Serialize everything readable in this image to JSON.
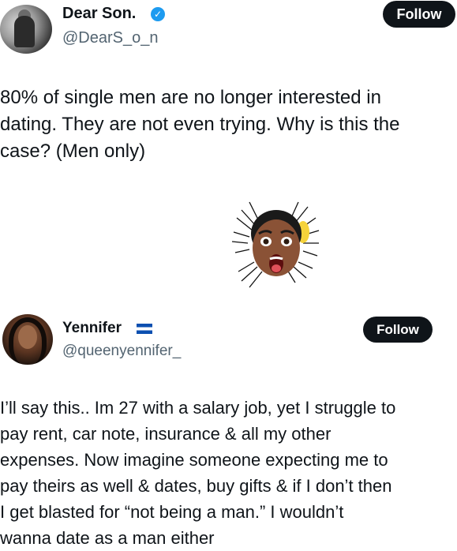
{
  "tweet1": {
    "author_name": "Dear Son.",
    "handle": "@DearS_o_n",
    "follow_label": "Follow",
    "text": "80% of single men are no longer interested in\ndating. They are not even trying. Why is this the\ncase? (Men only)"
  },
  "reply_image": {
    "icon": "shocked-face-emoji"
  },
  "tweet2": {
    "author_name": "Yennifer",
    "handle": "@queenyennifer_",
    "follow_label": "Follow",
    "text": "I’ll say this.. Im 27 with a salary job, yet I struggle to\npay rent, car note, insurance & all my other\nexpenses. Now imagine someone expecting me to\npay theirs as well & dates, buy gifts & if I don’t then\nI get blasted for “not being a man.” I wouldn’t\nwanna date as a man either"
  },
  "colors": {
    "verified": "#1d9bf0",
    "follow_bg": "#0f1419",
    "handle": "#536471"
  }
}
